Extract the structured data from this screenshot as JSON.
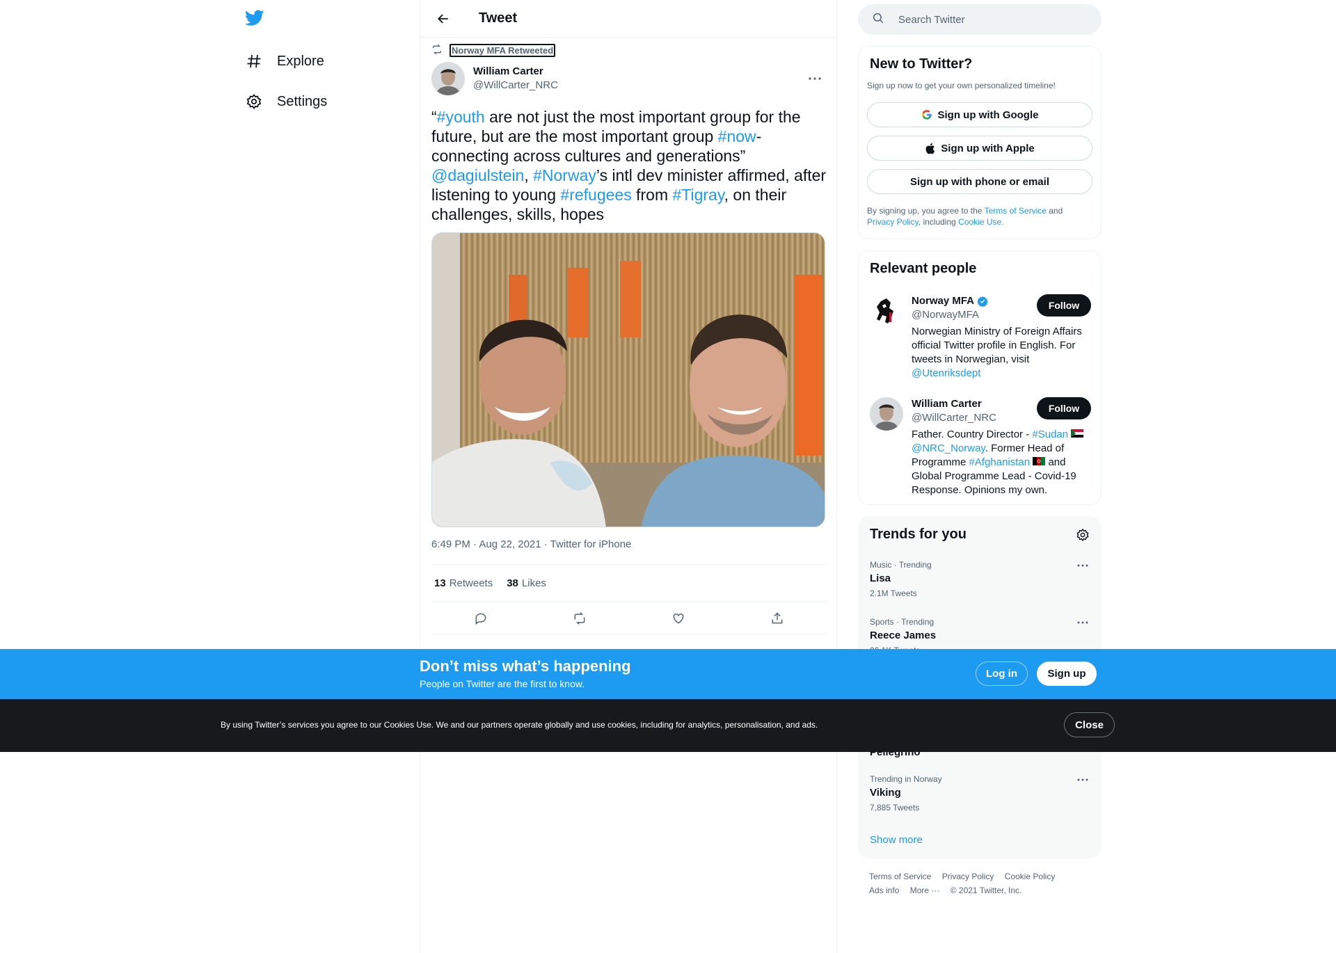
{
  "nav": {
    "logo": "twitter-bird-icon",
    "items": [
      {
        "label": "Explore",
        "icon": "hashtag-icon"
      },
      {
        "label": "Settings",
        "icon": "gear-icon"
      }
    ]
  },
  "header": {
    "title": "Tweet"
  },
  "tweet": {
    "retweeted_by": "Norway MFA Retweeted",
    "author_name": "William Carter",
    "author_handle": "@WillCarter_NRC",
    "text_parts": {
      "p1": "“",
      "h_youth": "#youth",
      "p2": " are not just the most important group for the future, but are the most important group ",
      "h_now": "#now",
      "p3": "-connecting across cultures and generations”",
      "m_dagi": "@dagiulstein",
      "p4": ", ",
      "h_norway": "#Norway",
      "p5": "’s intl dev minister affirmed, after listening to young ",
      "h_refugees": "#refugees",
      "p6": " from ",
      "h_tigray": "#Tigray",
      "p7": ", on their challenges, skills, hopes"
    },
    "meta": "6:49 PM · Aug 22, 2021 · Twitter for iPhone",
    "retweets_count": "13",
    "retweets_label": "Retweets",
    "likes_count": "38",
    "likes_label": "Likes"
  },
  "search": {
    "placeholder": "Search Twitter"
  },
  "signup_card": {
    "title": "New to Twitter?",
    "subtitle": "Sign up now to get your own personalized timeline!",
    "google": "Sign up with Google",
    "apple": "Sign up with Apple",
    "phone": "Sign up with phone or email",
    "legal_prefix": "By signing up, you agree to the ",
    "terms": "Terms of Service",
    "and": " and",
    "privacy": "Privacy Policy",
    "including": ", including ",
    "cookie_use": "Cookie Use."
  },
  "relevant": {
    "title": "Relevant people",
    "follow_label": "Follow",
    "people": [
      {
        "name": "Norway MFA",
        "handle": "@NorwayMFA",
        "bio": "Norwegian Ministry of Foreign Affairs official Twitter profile in English. For tweets in Norwegian, visit ",
        "bio_link": "@Utenriksdept"
      },
      {
        "name": "William Carter",
        "handle": "@WillCarter_NRC",
        "bio_a": "Father. Country Director - ",
        "bio_sudan": "#Sudan",
        "bio_nrc": "@NRC_Norway",
        "bio_b": ". Former Head of Programme ",
        "bio_afg": "#Afghanistan",
        "bio_c": " and Global Programme Lead - Covid-19 Response. Opinions my own."
      }
    ]
  },
  "trends": {
    "title": "Trends for you",
    "items": [
      {
        "context": "Music · Trending",
        "name": "Lisa",
        "count": "2.1M Tweets"
      },
      {
        "context": "Sports · Trending",
        "name": "Reece James",
        "count": "26.1K Tweets"
      },
      {
        "context": "",
        "name": "Pellegrino",
        "count": ""
      },
      {
        "context": "Trending in Norway",
        "name": "Viking",
        "count": "7,885 Tweets"
      }
    ],
    "show_more": "Show more"
  },
  "footer": {
    "links": [
      "Terms of Service",
      "Privacy Policy",
      "Cookie Policy",
      "Ads info",
      "More ···",
      "© 2021 Twitter, Inc."
    ]
  },
  "banner": {
    "title": "Don’t miss what’s happening",
    "subtitle": "People on Twitter are the first to know.",
    "login": "Log in",
    "signup": "Sign up"
  },
  "cookie": {
    "text": "By using Twitter’s services you agree to our Cookies Use. We and our partners operate globally and use cookies, including for analytics, personalisation, and ads.",
    "close": "Close"
  },
  "colors": {
    "accent": "#1d9bf0",
    "text": "#0f1419",
    "muted": "#536471",
    "cookie_bg": "#17191c"
  }
}
